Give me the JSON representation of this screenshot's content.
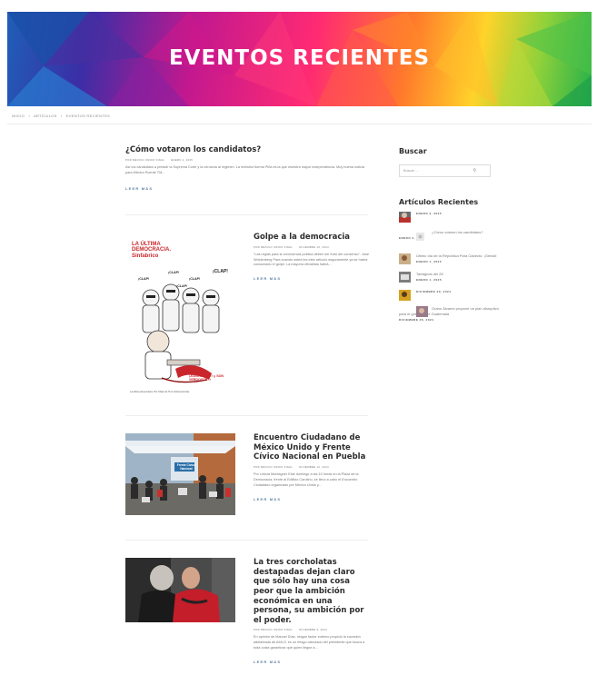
{
  "hero": {
    "title": "EVENTOS RECIENTES"
  },
  "breadcrumb": [
    "Inicio",
    "Artículos",
    "Eventos Recientes"
  ],
  "featured": {
    "title": "¿Cómo votaron los candidatos?",
    "author": "Por México Unido Sinal",
    "date": "Enero 2, 2025",
    "excerpt": "Así los candidatos a presidir la Suprema Corte y la cercanía al régimen. La ministra Norma Piña es la que muestra mayor independencia. Muy buena noticia para México Puente TM...",
    "read_more": "LEER MÁS"
  },
  "posts": [
    {
      "title": "Golpe a la democracia",
      "author": "Por México Unido Sinal",
      "date": "Diciembre 16, 2024",
      "excerpt": "\"Las reglas para la convivencia política deben ser fruto del consenso\". José Woldenberg Para cuando usted lea este artículo seguramente ya se habrá consumado el golpe. La mayoría oficialista habrá...",
      "read_more": "LEER MÁS",
      "image": {
        "headline": "LA ÚLTIMA DEMOCRACIA. Sinfabrico",
        "bubbles": [
          "¡CLAP!",
          "¡CLAP!",
          "¡CLAP!",
          "¡CLAP!",
          "¡CLAP!"
        ],
        "sign": "¡ZONGAATAS!! ¡¡ SON VERDOSOS !!",
        "caption": "La última democracia. Por Chalo de Tlmt. El Economista."
      }
    },
    {
      "title": "Encuentro Ciudadano de México Unido y Frente Cívico Nacional en Puebla",
      "author": "Por México Unido Sinal",
      "date": "Diciembre 12, 2024",
      "excerpt": "Por Leticia Montagner Este domingo a las 10 horas en la Plaza de la Democracia, frente al Edificio Carolino, se llevó a cabo el Encuentro Ciudadano organizado por México Unido y...",
      "read_more": "LEER MÁS",
      "image": {
        "banner": "Frente Cívico Nacional"
      }
    },
    {
      "title": "La tres corcholatas destapadas dejan claro que sólo hay una cosa peor que la ambición económica en una persona, su ambición por el poder.",
      "author": "Por México Unido Sinal",
      "date": "Diciembre 9, 2024",
      "excerpt": "En opinión de Manuel Díaz, ningún factor externo propició la sucesión adelantada de AMLO, es un riesgo calculado del presidente que busca a toda costa garantizar que quien llegue a...",
      "read_more": "LEER MÁS"
    }
  ],
  "sidebar": {
    "search_heading": "Buscar",
    "search_placeholder": "Buscar ...",
    "recent_heading": "Artículos Recientes",
    "recent": [
      {
        "title": "",
        "date": "Enero 3, 2025"
      },
      {
        "title": "¿Cómo votaron los candidatos?",
        "date": "Enero 2, 2025"
      },
      {
        "title": "Último día de la República Para Cabecto: ¡Genial!",
        "date": "Enero 1, 2025"
      },
      {
        "title": "Tartaguas del 28",
        "date": "Enero 1, 2025"
      },
      {
        "title": "",
        "date": "Diciembre 29, 2024"
      },
      {
        "title": "Grano Álvarez propone un plan disruptivo para el gobierno de Guatemala",
        "date": "Diciembre 26, 2024"
      }
    ]
  },
  "colors": {
    "accent": "#5a7fa4",
    "title": "#2d2d2d",
    "muted": "#777777"
  }
}
